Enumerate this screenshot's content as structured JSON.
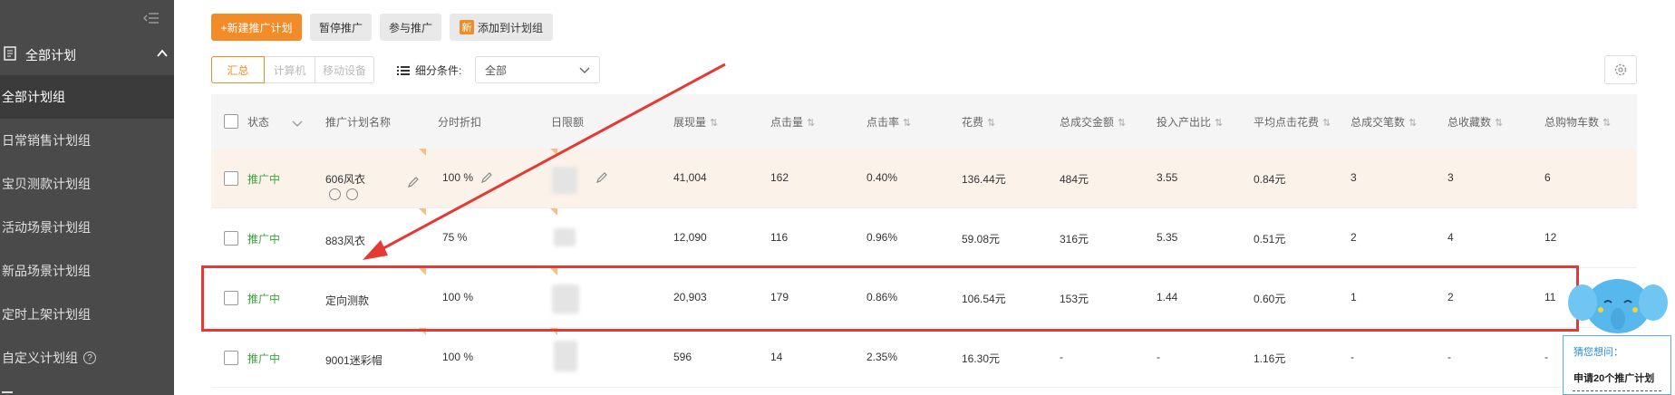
{
  "sidebar": {
    "header": "全部计划",
    "items": [
      {
        "label": "全部计划组"
      },
      {
        "label": "日常销售计划组"
      },
      {
        "label": "宝贝测款计划组"
      },
      {
        "label": "活动场景计划组"
      },
      {
        "label": "新品场景计划组"
      },
      {
        "label": "定时上架计划组"
      },
      {
        "label": "自定义计划组",
        "help": "?"
      }
    ]
  },
  "toolbar": {
    "new_plan": "+新建推广计划",
    "pause": "暂停推广",
    "join": "参与推广",
    "add_badge": "新",
    "add_to_group": "添加到计划组"
  },
  "view_tabs": [
    "汇总",
    "计算机",
    "移动设备"
  ],
  "filter": {
    "label": "细分条件:",
    "value": "全部"
  },
  "table": {
    "headers": {
      "status": "状态",
      "name": "推广计划名称",
      "discount": "分时折扣",
      "budget": "日限额",
      "impressions": "展现量",
      "clicks": "点击量",
      "ctr": "点击率",
      "cost": "花费",
      "gmv": "总成交金额",
      "roi": "投入产出比",
      "cpc": "平均点击花费",
      "orders": "总成交笔数",
      "favorites": "总收藏数",
      "carts": "总购物车数"
    },
    "sort_glyph": "⇅",
    "rows": [
      {
        "status": "推广中",
        "name": "606风衣",
        "discount": "100 %",
        "impressions": "41,004",
        "clicks": "162",
        "ctr": "0.40%",
        "cost": "136.44元",
        "gmv": "484元",
        "roi": "3.55",
        "cpc": "0.84元",
        "orders": "3",
        "favorites": "3",
        "carts": "6"
      },
      {
        "status": "推广中",
        "name": "883风衣",
        "discount": "75 %",
        "impressions": "12,090",
        "clicks": "116",
        "ctr": "0.96%",
        "cost": "59.08元",
        "gmv": "316元",
        "roi": "5.35",
        "cpc": "0.51元",
        "orders": "2",
        "favorites": "4",
        "carts": "12"
      },
      {
        "status": "推广中",
        "name": "定向测款",
        "discount": "100 %",
        "impressions": "20,903",
        "clicks": "179",
        "ctr": "0.86%",
        "cost": "106.54元",
        "gmv": "153元",
        "roi": "1.44",
        "cpc": "0.60元",
        "orders": "1",
        "favorites": "2",
        "carts": "11"
      },
      {
        "status": "推广中",
        "name": "9001迷彩帽",
        "discount": "100 %",
        "impressions": "596",
        "clicks": "14",
        "ctr": "2.35%",
        "cost": "16.30元",
        "gmv": "-",
        "roi": "-",
        "cpc": "1.16元",
        "orders": "-",
        "favorites": "-",
        "carts": "-"
      }
    ]
  },
  "suggestion": {
    "question": "猜您想问：",
    "answer": "申请20个推广计划"
  },
  "colors": {
    "accent": "#f28c28",
    "status_green": "#3da33d",
    "highlight_red": "#e53935"
  }
}
